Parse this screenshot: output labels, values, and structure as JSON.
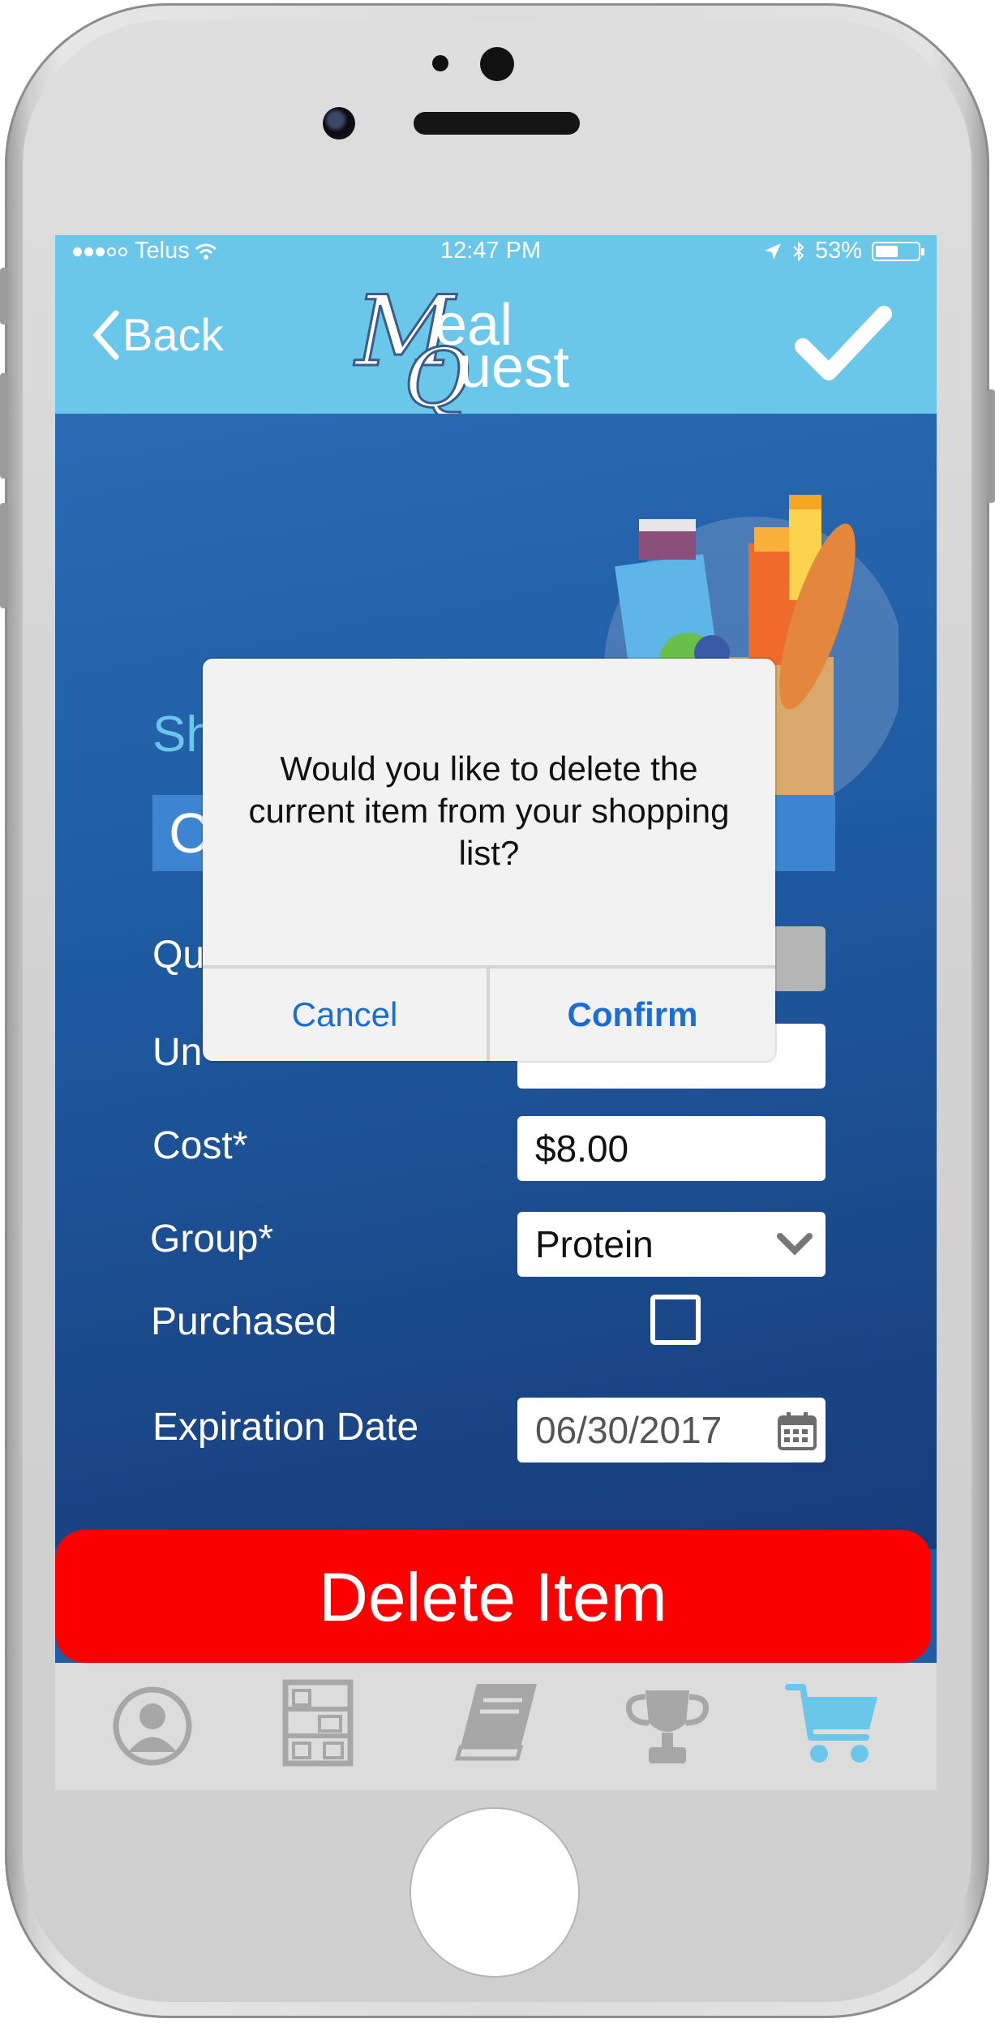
{
  "status_bar": {
    "carrier": "Telus",
    "time": "12:47 PM",
    "battery": "53%",
    "battery_level": 0.53,
    "signal_bars_filled": 3,
    "signal_bars_total": 5,
    "icons": [
      "wifi-icon",
      "location-arrow-icon",
      "bluetooth-icon",
      "battery-icon"
    ]
  },
  "nav": {
    "back_label": "Back",
    "logo_text": "MealQuest",
    "logo_letters": {
      "m": "M",
      "eal": "eal",
      "q": "Q",
      "uest": "uest"
    },
    "confirm_icon": "checkmark-icon"
  },
  "form": {
    "section_title_visible": "Sh",
    "name_visible": "C",
    "labels": {
      "quantity_visible": "Qu",
      "unit_visible": "Un",
      "cost": "Cost*",
      "group": "Group*",
      "purchased": "Purchased",
      "expiration": "Expiration Date"
    },
    "cost_value": "$8.00",
    "group_value": "Protein",
    "purchased_checked": false,
    "expiration_value": "06/30/2017"
  },
  "delete_button": "Delete Item",
  "tabs": [
    {
      "icon": "user-profile-icon",
      "active": false
    },
    {
      "icon": "pantry-shelves-icon",
      "active": false
    },
    {
      "icon": "recipe-book-icon",
      "active": false
    },
    {
      "icon": "trophy-icon",
      "active": false
    },
    {
      "icon": "shopping-cart-icon",
      "active": true
    }
  ],
  "dialog": {
    "message": "Would you like to delete the current item from your shopping list?",
    "cancel": "Cancel",
    "confirm": "Confirm"
  },
  "colors": {
    "header": "#6bc7e9",
    "background": "#1f5ca3",
    "delete": "#fc0000",
    "active_tab": "#6bc7e9",
    "inactive_tab": "#a7a7a7",
    "dialog_action": "#1a6dd8"
  }
}
